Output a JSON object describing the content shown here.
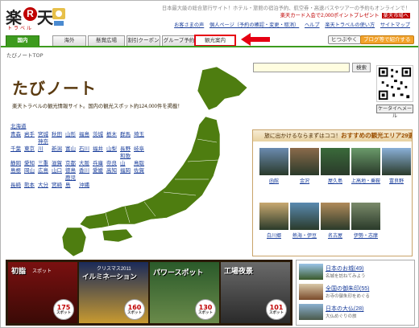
{
  "header": {
    "logo_text": "楽",
    "logo_r": "R",
    "logo_text2": "天",
    "logo_sub": "トラベル",
    "tagline": "日本最大級の総合旅行サイト！ホテル・旅館の宿泊予約、航空券・高速バスやツアーの予約もオンラインで！",
    "promo": "楽天カード入会で2,000ポイントプレゼント",
    "promo_link": "楽天市場へ",
    "links": [
      "お客さまの声",
      "個人ページ（予約の確認・変更・取消）",
      "ヘルプ",
      "楽天トラベルの使い方",
      "サイトマップ"
    ]
  },
  "tabs": [
    "国内",
    "海外",
    "懸賞広場",
    "割引クーポン",
    "グループ予約",
    "観光案内"
  ],
  "right_buttons": {
    "tweet": "ヒつぶやく",
    "blog": "ブログ等で紹介する"
  },
  "breadcrumb": "たびノートTOP",
  "search": {
    "placeholder": "",
    "button": "検索"
  },
  "mobile_button": "ケータイへメール",
  "hero": {
    "title": "たびノート",
    "subtitle": "楽天トラベルの観光情報サイト。国内の観光スポット約124,000件を掲載！"
  },
  "prefectures": {
    "head": "北海道",
    "items": [
      "青森",
      "岩手",
      "宮城",
      "秋田",
      "山形",
      "福島",
      "茨城",
      "栃木",
      "群馬",
      "埼玉",
      "千葉",
      "東京",
      "神奈川",
      "新潟",
      "富山",
      "石川",
      "福井",
      "山梨",
      "長野",
      "岐阜",
      "静岡",
      "愛知",
      "三重",
      "滋賀",
      "京都",
      "大阪",
      "兵庫",
      "奈良",
      "和歌山",
      "鳥取",
      "島根",
      "岡山",
      "広島",
      "山口",
      "徳島",
      "香川",
      "愛媛",
      "高知",
      "福岡",
      "佐賀",
      "長崎",
      "熊本",
      "大分",
      "宮崎",
      "鹿児島",
      "沖縄"
    ]
  },
  "areas": {
    "heading_pre": "旅に出かけるならまずはココ！",
    "heading": "おすすめの観光エリア29選",
    "items": [
      "函館",
      "金沢",
      "屋久島",
      "上高地・乗鞍",
      "富良野",
      "白川郷",
      "熱海・伊豆",
      "名古屋",
      "伊勢・志摩"
    ]
  },
  "banners": [
    {
      "title": "初詣",
      "sub": "スポット",
      "count": "175"
    },
    {
      "title": "イルミネーション",
      "sub": "クリスマス2011",
      "count": "160"
    },
    {
      "title": "パワースポット",
      "sub": "",
      "count": "130"
    },
    {
      "title": "工場夜景",
      "sub": "",
      "count": "101"
    }
  ],
  "features": [
    {
      "title": "日本のお城(49)",
      "sub": "名城を訪ねてみよう"
    },
    {
      "title": "全国の御朱印(55)",
      "sub": "お寺の御朱印をめぐる"
    },
    {
      "title": "日本の大仏(28)",
      "sub": "大仏めぐりの旅"
    }
  ],
  "colors": {
    "brand_red": "#bf0000",
    "tab_green": "#3d9b1e",
    "map_green": "#4e7d10",
    "highlight": "#e60012"
  }
}
